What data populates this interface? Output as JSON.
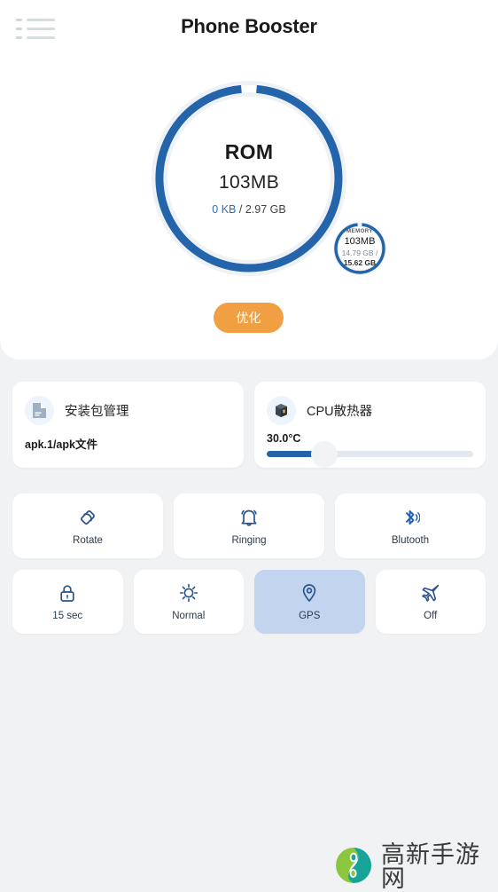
{
  "header": {
    "title": "Phone Booster",
    "menu_icon": "hamburger-list-icon"
  },
  "gauge": {
    "label": "ROM",
    "value": "103MB",
    "used": "0 KB",
    "separator": " / ",
    "total": "2.97 GB",
    "arc_color": "#2364ab",
    "track_color": "#eaeff5",
    "percent": 97
  },
  "mini_gauge": {
    "label": "MEMORY",
    "value": "103MB",
    "sub_line1": "14.79 GB /",
    "sub_line2": "15.62 GB",
    "arc_color": "#2364ab",
    "percent": 95
  },
  "optimize_button": {
    "label": "优化",
    "color": "#f0a042"
  },
  "cards": [
    {
      "icon": "document-file-icon",
      "title": "安装包管理",
      "footer": "apk.1/apk文件"
    },
    {
      "icon": "cpu-chip-icon",
      "title": "CPU散热器",
      "temperature": "30.0°C",
      "slider_percent": 28
    }
  ],
  "toggles_row1": [
    {
      "icon": "rotate-icon",
      "label": "Rotate",
      "active": false
    },
    {
      "icon": "bell-icon",
      "label": "Ringing",
      "active": false
    },
    {
      "icon": "bluetooth-icon",
      "label": "Blutooth",
      "active": false
    }
  ],
  "toggles_row2": [
    {
      "icon": "lock-icon",
      "label": "15 sec",
      "active": false
    },
    {
      "icon": "brightness-sun-icon",
      "label": "Normal",
      "active": false
    },
    {
      "icon": "location-pin-icon",
      "label": "GPS",
      "active": true
    },
    {
      "icon": "airplane-icon",
      "label": "Off",
      "active": false
    }
  ],
  "watermark": {
    "text": "高新手游网",
    "logo": "leaf-circle-logo",
    "green": "#8cc63e",
    "teal": "#17a398"
  }
}
